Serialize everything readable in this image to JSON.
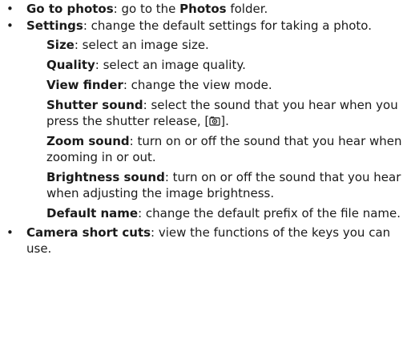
{
  "items": [
    {
      "bullet": "•",
      "term": "Go to photos",
      "text_before": ": go to the ",
      "bold_mid": "Photos",
      "text_after": " folder."
    },
    {
      "bullet": "•",
      "term": "Settings",
      "text": ": change the default settings for taking a photo.",
      "sub": [
        {
          "term": "Size",
          "text": ": select an image size."
        },
        {
          "term": "Quality",
          "text": ": select an image quality."
        },
        {
          "term": "View finder",
          "text": ": change the view mode."
        },
        {
          "term": "Shutter sound",
          "text": ": select the sound that you hear when you press the shutter release, [",
          "text_after": "]."
        },
        {
          "term": "Zoom sound",
          "text": ": turn on or off the sound that you hear when zooming in or out."
        },
        {
          "term": "Brightness sound",
          "text": ": turn on or off the sound that you hear when adjusting the image brightness."
        },
        {
          "term": "Default name",
          "text": ": change the default prefix of the file name."
        }
      ]
    },
    {
      "bullet": "•",
      "term": "Camera short cuts",
      "text": ": view the functions of the keys you can use."
    }
  ],
  "icons": {
    "shutter_key": "camera-key-icon"
  }
}
